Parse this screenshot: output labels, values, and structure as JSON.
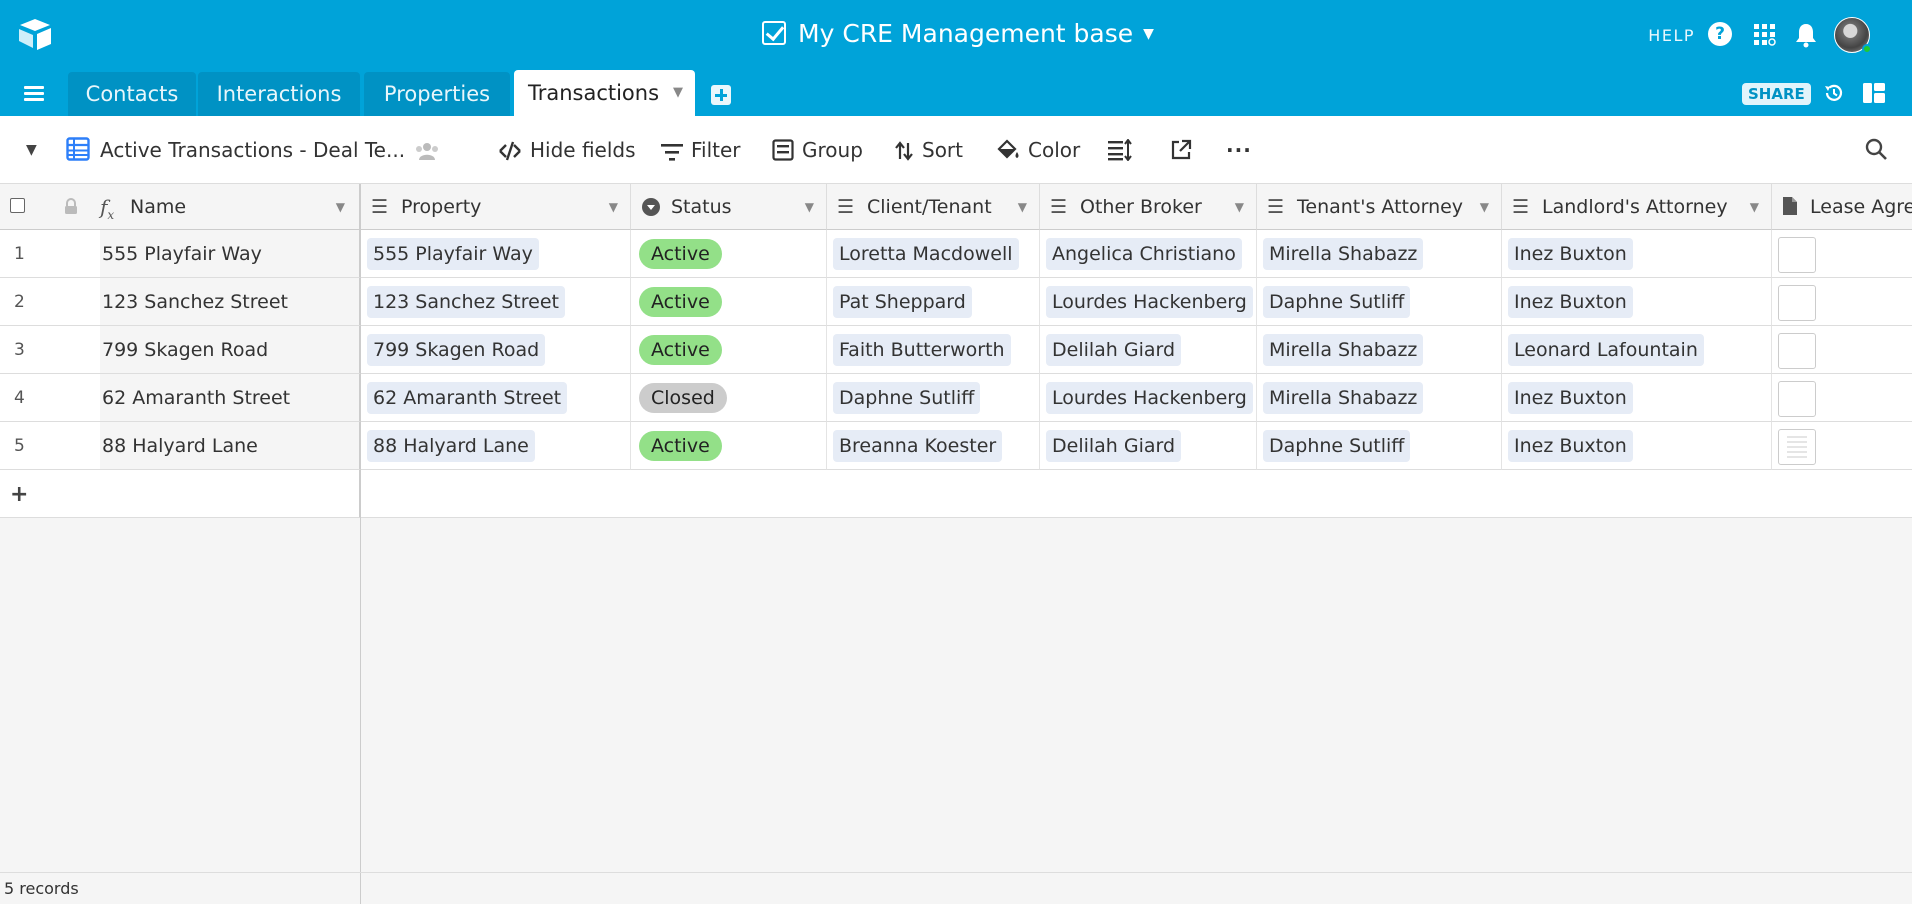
{
  "app": {
    "base_title": "My CRE Management base",
    "help_label": "HELP"
  },
  "tabs": [
    {
      "label": "Contacts"
    },
    {
      "label": "Interactions"
    },
    {
      "label": "Properties"
    },
    {
      "label": "Transactions"
    }
  ],
  "share_label": "SHARE",
  "toolbar": {
    "view_name": "Active Transactions - Deal Te...",
    "hide_fields": "Hide fields",
    "filter": "Filter",
    "group": "Group",
    "sort": "Sort",
    "color": "Color",
    "more": "···"
  },
  "columns": {
    "name": "Name",
    "property": "Property",
    "status": "Status",
    "client": "Client/Tenant",
    "other_broker": "Other Broker",
    "tenant_attorney": "Tenant's Attorney",
    "landlord_attorney": "Landlord's Attorney",
    "lease": "Lease Agree"
  },
  "rows": [
    {
      "num": "1",
      "name": "555 Playfair Way",
      "property": "555 Playfair Way",
      "status": "Active",
      "client": "Loretta Macdowell",
      "other_broker": "Angelica Christiano",
      "tenant_attorney": "Mirella Shabazz",
      "landlord_attorney": "Inez Buxton"
    },
    {
      "num": "2",
      "name": "123 Sanchez Street",
      "property": "123 Sanchez Street",
      "status": "Active",
      "client": "Pat Sheppard",
      "other_broker": "Lourdes Hackenberg",
      "tenant_attorney": "Daphne Sutliff",
      "landlord_attorney": "Inez Buxton"
    },
    {
      "num": "3",
      "name": "799 Skagen Road",
      "property": "799 Skagen Road",
      "status": "Active",
      "client": "Faith Butterworth",
      "other_broker": "Delilah Giard",
      "tenant_attorney": "Mirella Shabazz",
      "landlord_attorney": "Leonard Lafountain"
    },
    {
      "num": "4",
      "name": "62 Amaranth Street",
      "property": "62 Amaranth Street",
      "status": "Closed",
      "client": "Daphne Sutliff",
      "other_broker": "Lourdes Hackenberg",
      "tenant_attorney": "Mirella Shabazz",
      "landlord_attorney": "Inez Buxton"
    },
    {
      "num": "5",
      "name": "88 Halyard Lane",
      "property": "88 Halyard Lane",
      "status": "Active",
      "client": "Breanna Koester",
      "other_broker": "Delilah Giard",
      "tenant_attorney": "Daphne Sutliff",
      "landlord_attorney": "Inez Buxton"
    }
  ],
  "footer": {
    "record_count": "5 records"
  },
  "colors": {
    "brand": "#00a3d9",
    "status_active": "#93e088",
    "status_closed": "#cccccc"
  }
}
